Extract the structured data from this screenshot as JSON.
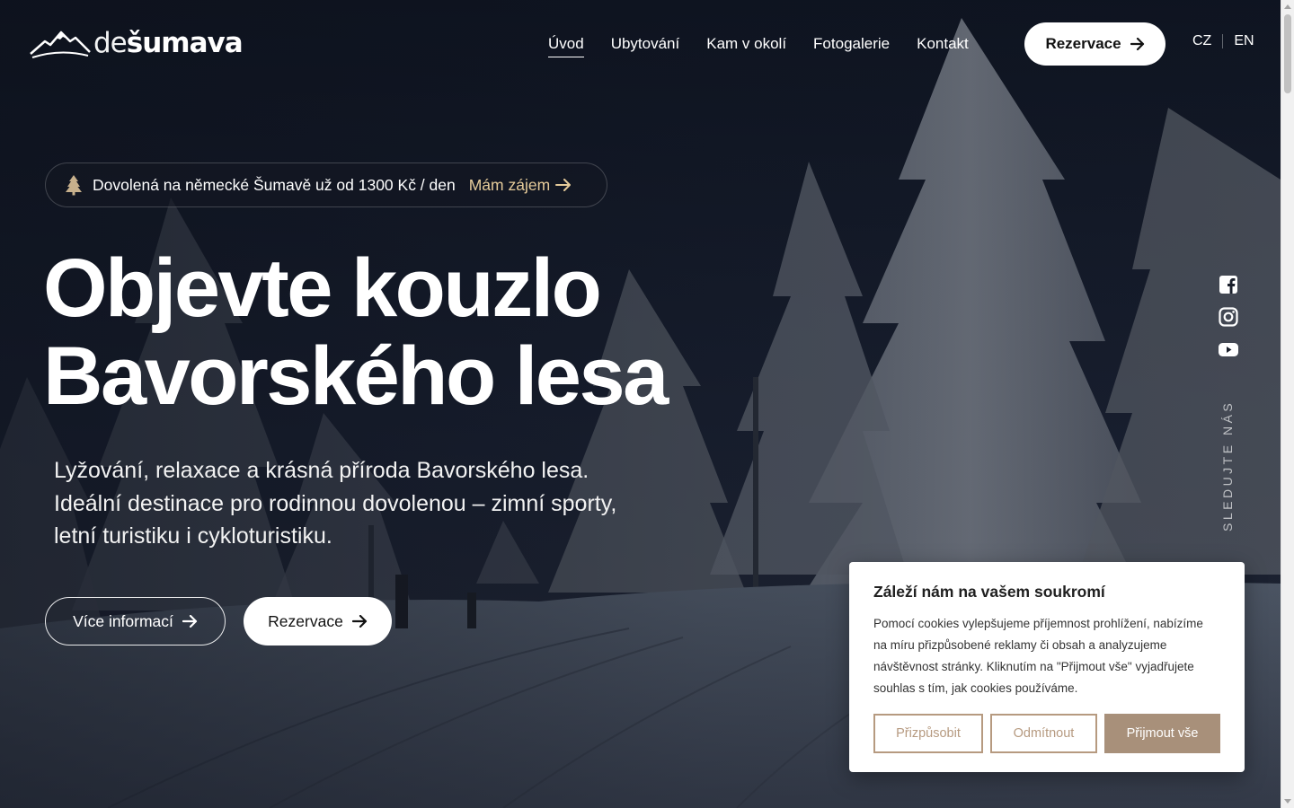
{
  "brand": {
    "logo_prefix": "de",
    "logo_name": "šumava"
  },
  "nav": {
    "items": [
      {
        "label": "Úvod",
        "active": true
      },
      {
        "label": "Ubytování",
        "active": false
      },
      {
        "label": "Kam v okolí",
        "active": false
      },
      {
        "label": "Fotogalerie",
        "active": false
      },
      {
        "label": "Kontakt",
        "active": false
      }
    ],
    "reserve_label": "Rezervace"
  },
  "lang": {
    "cz": "CZ",
    "en": "EN"
  },
  "promo": {
    "text": "Dovolená na německé Šumavě už od 1300 Kč / den",
    "link": "Mám zájem"
  },
  "hero": {
    "headline_line1": "Objevte kouzlo",
    "headline_line2": "Bavorského lesa",
    "sub_line1": "Lyžování, relaxace a krásná příroda Bavorského lesa.",
    "sub_line2": "Ideální destinace pro rodinnou dovolenou – zimní sporty,",
    "sub_line3": "letní turistiku i cykloturistiku.",
    "more_label": "Více informací",
    "reserve_label": "Rezervace"
  },
  "social": {
    "icons": [
      "facebook-icon",
      "instagram-icon",
      "youtube-icon"
    ],
    "follow_label": "SLEDUJTE NÁS"
  },
  "cookie": {
    "title": "Záleží nám na vašem soukromí",
    "text": "Pomocí cookies vylepšujeme příjemnost prohlížení, nabízíme na míru přizpůsobené reklamy či obsah a analyzujeme návštěvnost stránky. Kliknutím na \"Přijmout vše\" vyjadřujete souhlas s tím, jak cookies používáme.",
    "customize": "Přizpůsobit",
    "reject": "Odmítnout",
    "accept": "Přijmout vše"
  },
  "colors": {
    "accent_gold": "#e5cb9a",
    "cookie_brown": "#a8907a",
    "cookie_outline": "#b69a80"
  }
}
